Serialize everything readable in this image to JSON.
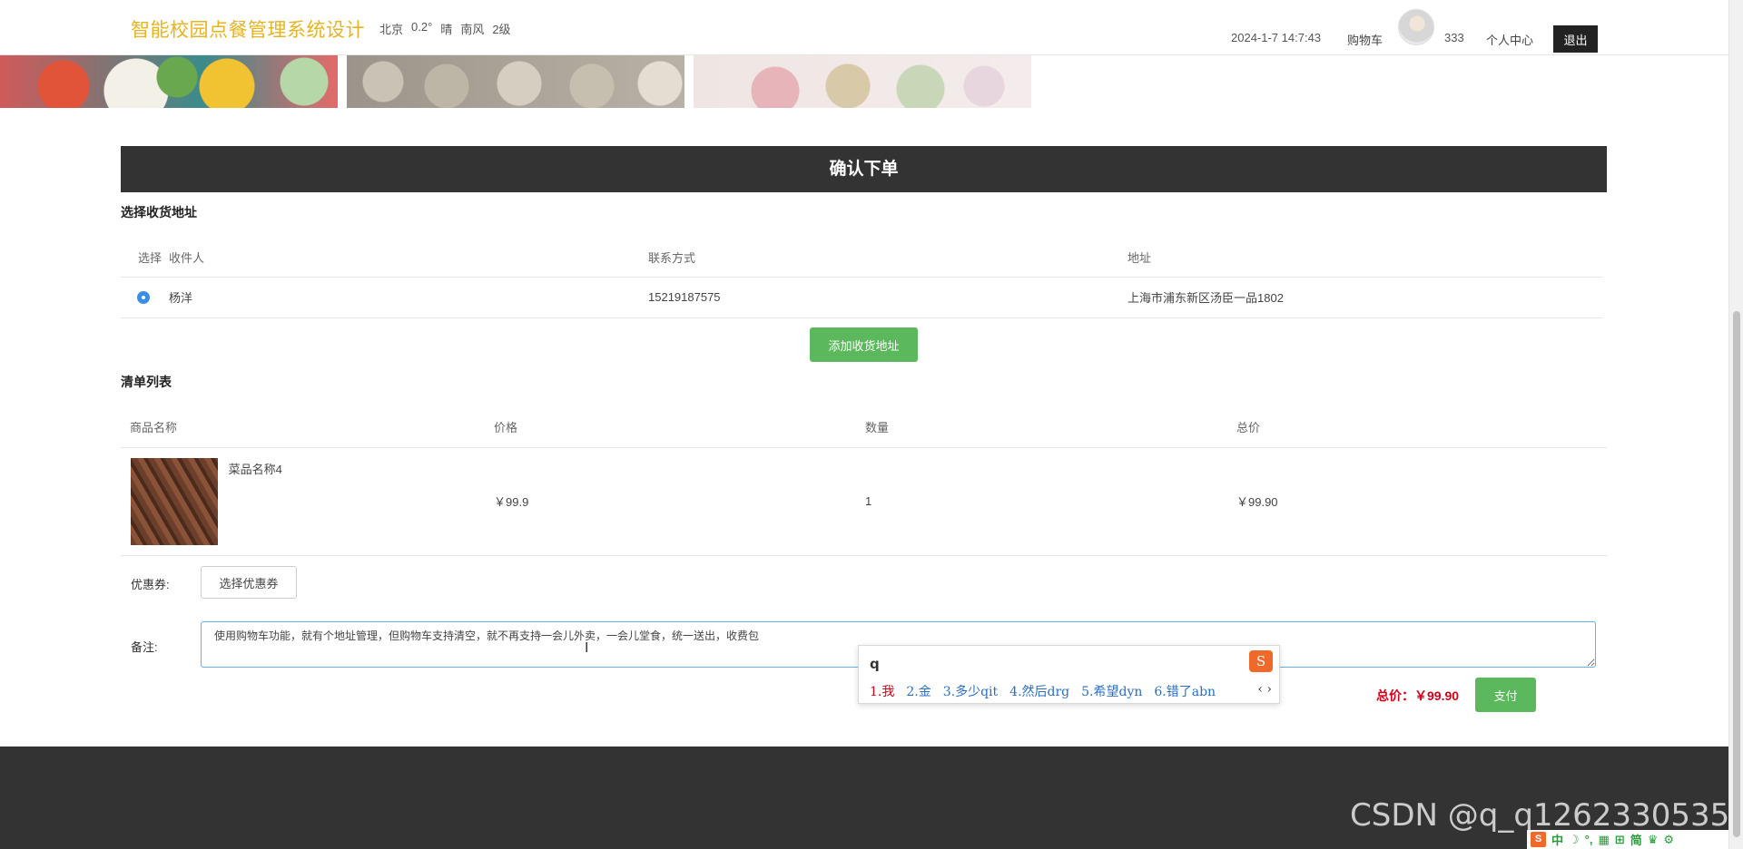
{
  "header": {
    "site_title": "智能校园点餐管理系统设计",
    "weather": {
      "city": "北京",
      "temp": "0.2°",
      "condition": "晴",
      "wind": "南风",
      "level": "2级"
    },
    "datetime": "2024-1-7 14:7:43",
    "cart": "购物车",
    "username": "333",
    "profile": "个人中心",
    "logout": "退出"
  },
  "confirm_title": "确认下单",
  "address_section": {
    "title": "选择收货地址",
    "columns": [
      "选择",
      "收件人",
      "联系方式",
      "地址"
    ],
    "rows": [
      {
        "selected": true,
        "name": "杨洋",
        "phone": "15219187575",
        "address": "上海市浦东新区汤臣一品1802"
      }
    ],
    "add_button": "添加收货地址"
  },
  "order_section": {
    "title": "清单列表",
    "columns": [
      "商品名称",
      "价格",
      "数量",
      "总价"
    ],
    "rows": [
      {
        "name": "菜品名称4",
        "price": "￥99.9",
        "qty": "1",
        "total": "￥99.90"
      }
    ]
  },
  "coupon": {
    "label": "优惠券:",
    "button": "选择优惠券"
  },
  "remark": {
    "label": "备注:",
    "value": "使用购物车功能，就有个地址管理，但购物车支持清空，就不再支持一会儿外卖，一会儿堂食，统一送出，收费包"
  },
  "total": {
    "label": "总价：￥99.90"
  },
  "pay_button": "支付",
  "ime": {
    "input": "q",
    "candidates": [
      "1.我",
      "2.金",
      "3.多少qit",
      "4.然后drg",
      "5.希望dyn",
      "6.错了abn"
    ],
    "logo": "S",
    "nav": "‹ ›"
  },
  "watermark": "CSDN @q_q1262330535",
  "ime_tray": [
    "中",
    "☽",
    "°,",
    "▦",
    "⊞",
    "简",
    "♛",
    "⚙"
  ]
}
